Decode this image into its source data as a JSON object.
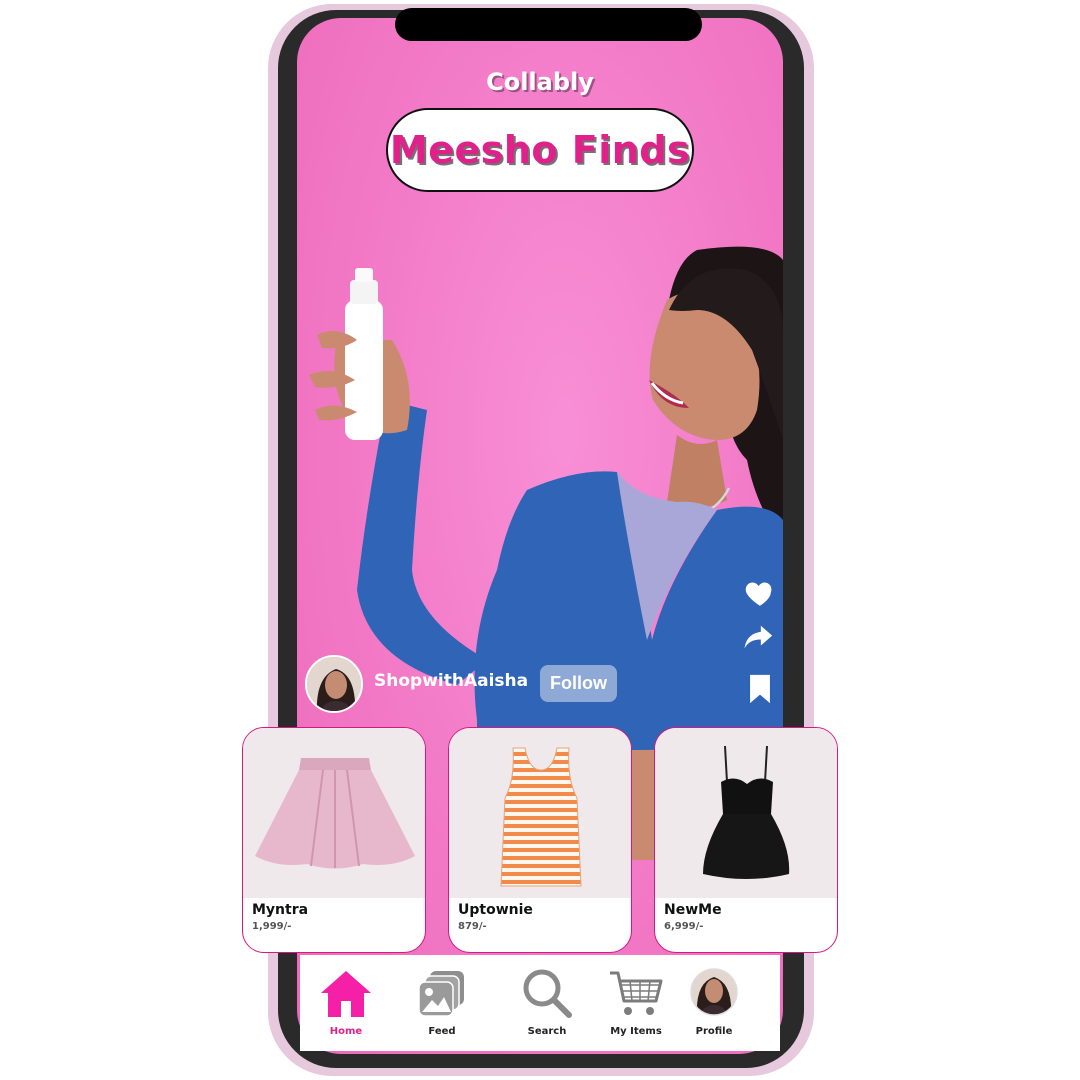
{
  "app": {
    "name": "Collably"
  },
  "hero": {
    "title": "Meesho Finds"
  },
  "creator": {
    "handle": "ShopwithAaisha",
    "follow_label": "Follow"
  },
  "actions": [
    {
      "icon": "heart-icon"
    },
    {
      "icon": "share-icon"
    },
    {
      "icon": "bookmark-icon"
    }
  ],
  "products": [
    {
      "brand": "Myntra",
      "price": "1,999/-",
      "item": "pink-skirt"
    },
    {
      "brand": "Uptownie",
      "price": "879/-",
      "item": "striped-tank-top"
    },
    {
      "brand": "NewMe",
      "price": "6,999/-",
      "item": "black-dress"
    }
  ],
  "nav": {
    "items": [
      {
        "label": "Home",
        "icon": "home-icon",
        "active": true
      },
      {
        "label": "Feed",
        "icon": "gallery-icon",
        "active": false
      },
      {
        "label": "Search",
        "icon": "search-icon",
        "active": false
      },
      {
        "label": "My Items",
        "icon": "cart-icon",
        "active": false
      },
      {
        "label": "Profile",
        "icon": "avatar",
        "active": false
      }
    ]
  },
  "colors": {
    "accent": "#e0218a",
    "background": "#f279c6",
    "card_border": "#d31a82"
  }
}
